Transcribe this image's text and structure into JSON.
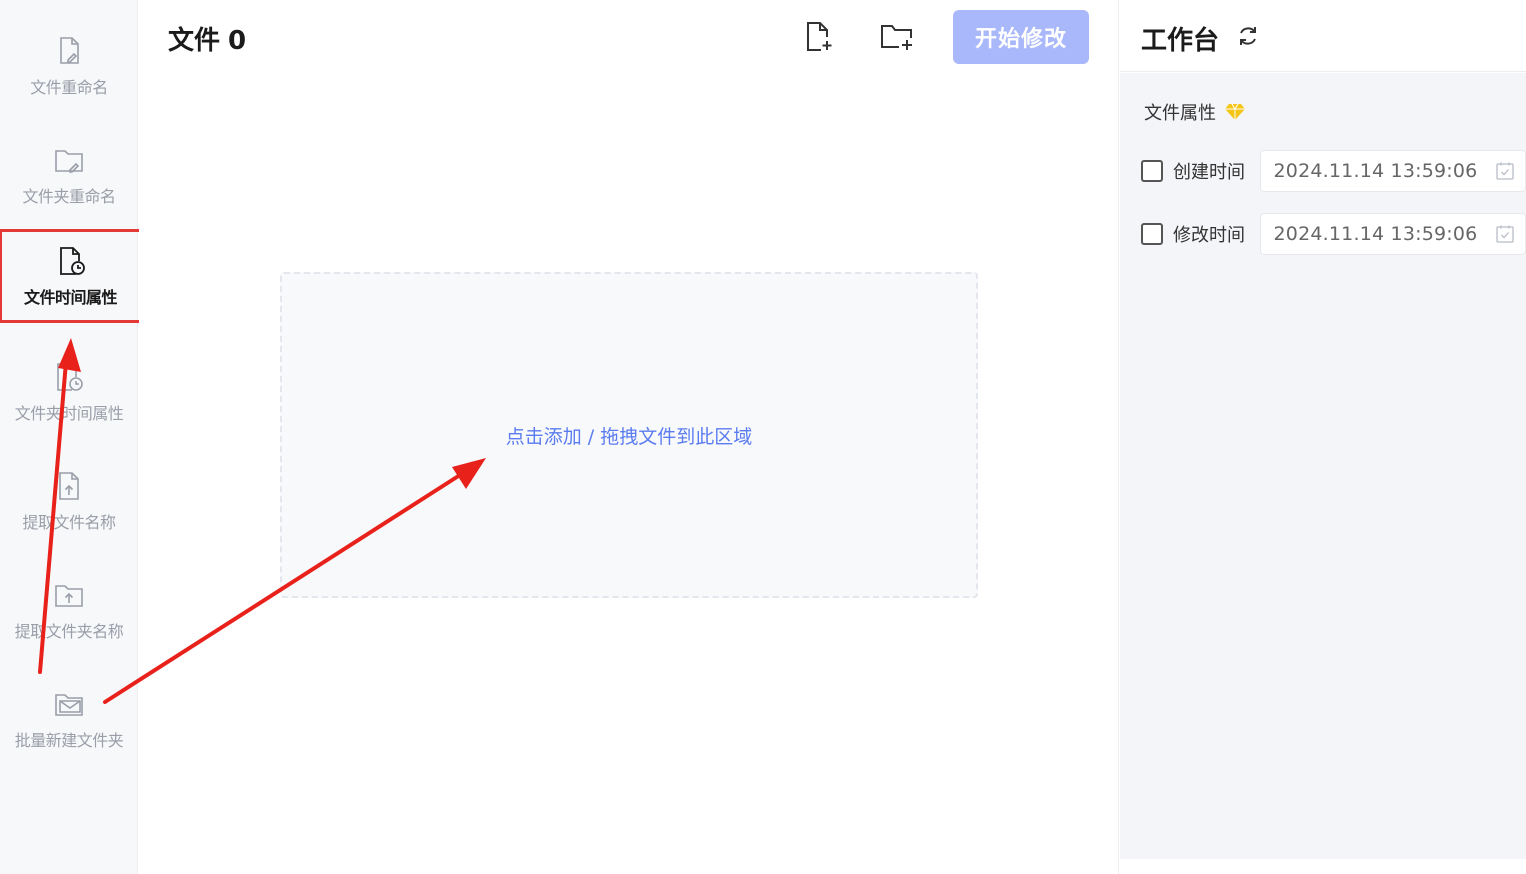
{
  "sidebar": {
    "items": [
      {
        "label": "文件重命名",
        "icon": "file-edit-icon"
      },
      {
        "label": "文件夹重命名",
        "icon": "folder-edit-icon"
      },
      {
        "label": "文件时间属性",
        "icon": "file-clock-icon",
        "active": true
      },
      {
        "label": "文件夹时间属性",
        "icon": "folder-clock-icon"
      },
      {
        "label": "提取文件名称",
        "icon": "file-upload-icon"
      },
      {
        "label": "提取文件夹名称",
        "icon": "folder-upload-icon"
      },
      {
        "label": "批量新建文件夹",
        "icon": "folder-mail-icon"
      }
    ]
  },
  "main": {
    "title": "文件",
    "count": "0",
    "start_label": "开始修改",
    "drop_text": "点击添加 / 拖拽文件到此区域"
  },
  "panel": {
    "title": "工作台",
    "section_title": "文件属性",
    "rows": [
      {
        "label": "创建时间",
        "value": "2024.11.14 13:59:06"
      },
      {
        "label": "修改时间",
        "value": "2024.11.14 13:59:06"
      }
    ]
  },
  "colors": {
    "accent": "#5b7cf0",
    "start_button": "#a9b7fb",
    "highlight": "#e53935",
    "diamond": "#f5c518"
  }
}
